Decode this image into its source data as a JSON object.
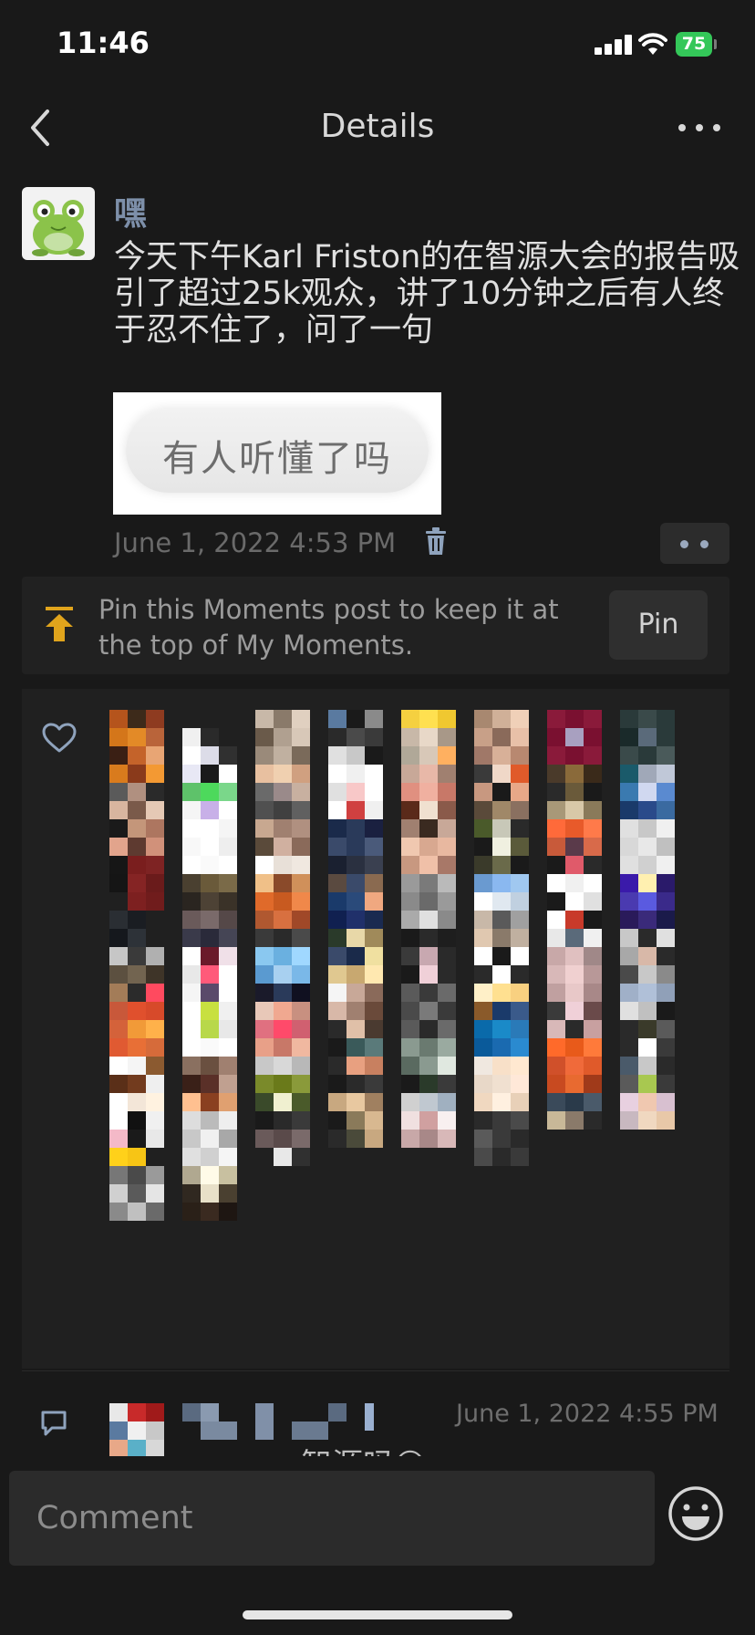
{
  "status_bar": {
    "time": "11:46",
    "battery": "75"
  },
  "nav": {
    "title": "Details"
  },
  "post": {
    "username": "嘿",
    "text": "今天下午Karl Friston的在智源大会的报告吸引了超过25k观众，讲了10分钟之后有人终于忍不住了，问了一句",
    "image_text": "有人听懂了吗",
    "time": "June 1, 2022 4:53 PM"
  },
  "pin": {
    "text": "Pin this Moments post to keep it at the top of My Moments.",
    "button_label": "Pin"
  },
  "comment": {
    "time": "June 1, 2022 4:55 PM",
    "partial_text": "智源吗😁"
  },
  "bottom_bar": {
    "comment_placeholder": "Comment"
  },
  "colors": {
    "accent_yellow": "#e0a41c",
    "link_name": "#7d8fa9",
    "battery_green": "#34c759"
  }
}
